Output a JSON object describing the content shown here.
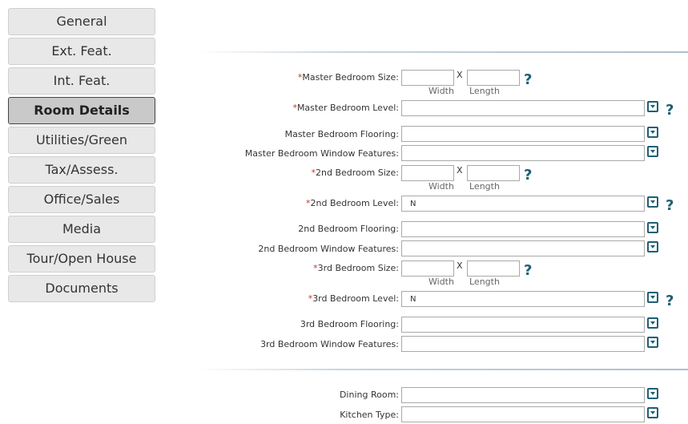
{
  "sidebar": {
    "items": [
      {
        "label": "General",
        "active": false
      },
      {
        "label": "Ext. Feat.",
        "active": false
      },
      {
        "label": "Int. Feat.",
        "active": false
      },
      {
        "label": "Room Details",
        "active": true
      },
      {
        "label": "Utilities/Green",
        "active": false
      },
      {
        "label": "Tax/Assess.",
        "active": false
      },
      {
        "label": "Office/Sales",
        "active": false
      },
      {
        "label": "Media",
        "active": false
      },
      {
        "label": "Tour/Open House",
        "active": false
      },
      {
        "label": "Documents",
        "active": false
      }
    ]
  },
  "form": {
    "required_mark": "*",
    "dims": {
      "x": "X",
      "width": "Width",
      "length": "Length"
    },
    "help": "?",
    "master": {
      "size_label": "Master Bedroom Size:",
      "level_label": "Master Bedroom Level:",
      "level_value": "",
      "flooring_label": "Master Bedroom Flooring:",
      "window_label": "Master Bedroom Window Features:"
    },
    "second": {
      "size_label": "2nd Bedroom Size:",
      "level_label": "2nd Bedroom Level:",
      "level_value": "N",
      "flooring_label": "2nd Bedroom Flooring:",
      "window_label": "2nd Bedroom Window Features:"
    },
    "third": {
      "size_label": "3rd Bedroom Size:",
      "level_label": "3rd Bedroom Level:",
      "level_value": "N",
      "flooring_label": "3rd Bedroom Flooring:",
      "window_label": "3rd Bedroom Window Features:"
    },
    "dining_label": "Dining Room:",
    "kitchen_label": "Kitchen Type:"
  },
  "colors": {
    "required": "#c0392b",
    "accent": "#1e5f74"
  },
  "icons": {
    "dropdown": "dropdown-arrow-icon",
    "help": "question-mark-icon"
  }
}
